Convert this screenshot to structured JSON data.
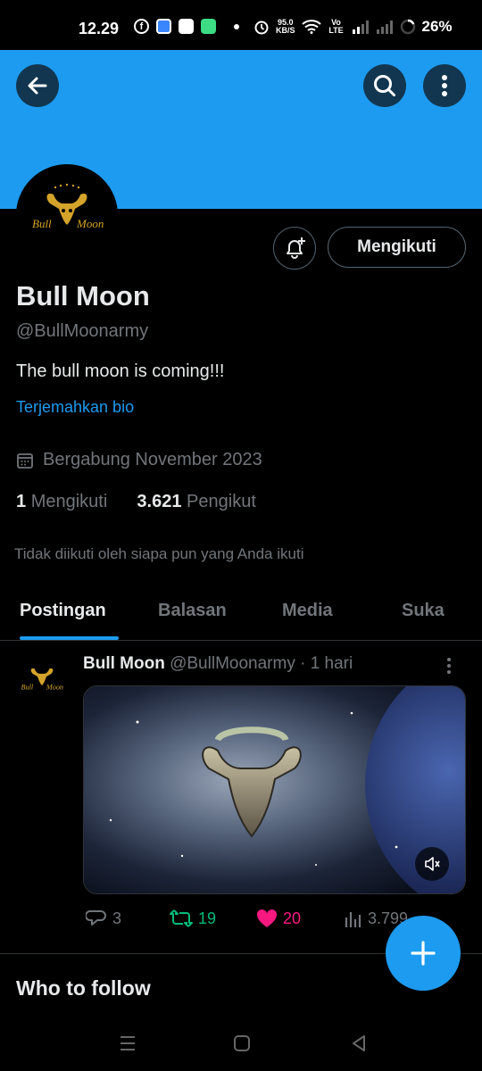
{
  "status_bar": {
    "time": "12.29",
    "speed_value": "95.0",
    "speed_unit": "KB/S",
    "network": "Vo LTE",
    "battery": "26%"
  },
  "header": {
    "back_icon": "arrow-left-icon",
    "search_icon": "search-icon",
    "more_icon": "more-vertical-icon"
  },
  "profile": {
    "name": "Bull Moon",
    "handle": "@BullMoonarmy",
    "bio": "The bull moon is coming!!!",
    "translate_bio": "Terjemahkan bio",
    "joined": "Bergabung November 2023",
    "following_count": "1",
    "following_label": "Mengikuti",
    "followers_count": "3.621",
    "followers_label": "Pengikut",
    "not_followed_note": "Tidak diikuti oleh siapa pun yang Anda ikuti",
    "follow_button": "Mengikuti",
    "avatar_logo_text": "Bull Moon"
  },
  "tabs": [
    {
      "label": "Postingan",
      "active": true
    },
    {
      "label": "Balasan",
      "active": false
    },
    {
      "label": "Media",
      "active": false
    },
    {
      "label": "Suka",
      "active": false
    }
  ],
  "post": {
    "author": "Bull Moon",
    "handle": "@BullMoonarmy",
    "time": "· 1 hari",
    "replies": "3",
    "reposts": "19",
    "likes": "20",
    "views": "3.799"
  },
  "who_to_follow": "Who to follow",
  "colors": {
    "accent": "#1d9bf0",
    "repost": "#00ba7c",
    "like": "#f91880",
    "muted": "#71767b",
    "logo_gold": "#d4a32a"
  }
}
